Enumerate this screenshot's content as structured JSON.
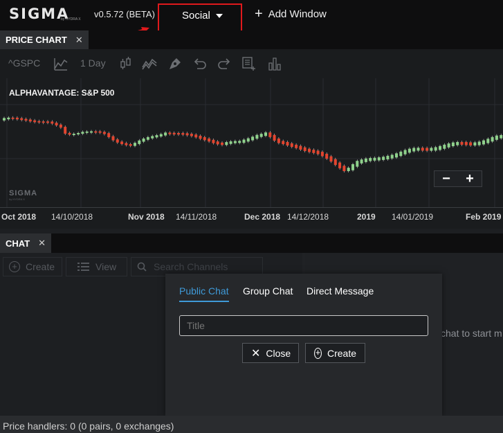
{
  "app": {
    "logo": "SIGMA",
    "logo_sub": "by HYDRA X",
    "version": "v0.5.72 (BETA)"
  },
  "topbar": {
    "window_select": "Social",
    "add_window": "Add Window"
  },
  "price_chart": {
    "tab_label": "PRICE CHART",
    "symbol": "^GSPC",
    "interval": "1 Day",
    "chart_title": "ALPHAVANTAGE: S&P 500",
    "watermark": "SIGMA",
    "watermark_sub": "by HYDRA X",
    "zoom_out": "−",
    "zoom_in": "+"
  },
  "chart_data": {
    "type": "candlestick",
    "title": "ALPHAVANTAGE: S&P 500",
    "x_tick_labels": [
      "Oct 2018",
      "14/10/2018",
      "Nov 2018",
      "14/11/2018",
      "Dec 2018",
      "14/12/2018",
      "2019",
      "14/01/2019",
      "Feb 2019"
    ],
    "bold_ticks": [
      "Oct 2018",
      "Nov 2018",
      "Dec 2018",
      "2019",
      "Feb 2019"
    ],
    "up_color": "#8fd18c",
    "down_color": "#e2452f",
    "grid": true
  },
  "chat": {
    "tab_label": "CHAT",
    "create_label": "Create",
    "view_label": "View",
    "search_placeholder": "Search Channels",
    "hint": "chat to start m"
  },
  "modal": {
    "tabs": [
      "Public Chat",
      "Group Chat",
      "Direct Message"
    ],
    "active_tab": "Public Chat",
    "title_placeholder": "Title",
    "close_label": "Close",
    "create_label": "Create"
  },
  "status": {
    "text": "Price handlers: 0 (0 pairs, 0 exchanges)"
  },
  "colors": {
    "highlight_box": "#e0191c",
    "accent": "#3f9ad8"
  }
}
